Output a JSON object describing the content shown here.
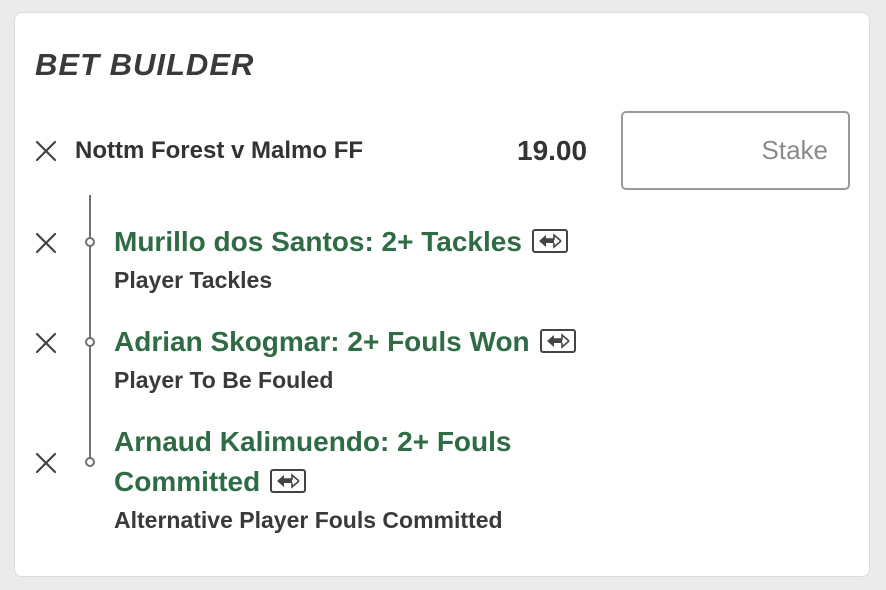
{
  "bet_builder": {
    "title": "BET BUILDER",
    "event": {
      "name": "Nottm Forest v Malmo FF",
      "odds": "19.00",
      "stake_placeholder": "Stake",
      "stake_value": ""
    },
    "selections": [
      {
        "name_line1": "Murillo dos Santos: 2+ Tackles",
        "name_line2": "",
        "market": "Player Tackles"
      },
      {
        "name_line1": "Adrian Skogmar: 2+ Fouls Won",
        "name_line2": "",
        "market": "Player To Be Fouled"
      },
      {
        "name_line1": "Arnaud Kalimuendo: 2+ Fouls",
        "name_line2": "Committed",
        "market": "Alternative Player Fouls Committed"
      }
    ]
  },
  "icons": {
    "remove": "close-icon",
    "swap": "swap-icon"
  },
  "colors": {
    "selection_green": "#2f6b45",
    "text_dark": "#333333",
    "background": "#ebebeb",
    "card": "#ffffff"
  }
}
